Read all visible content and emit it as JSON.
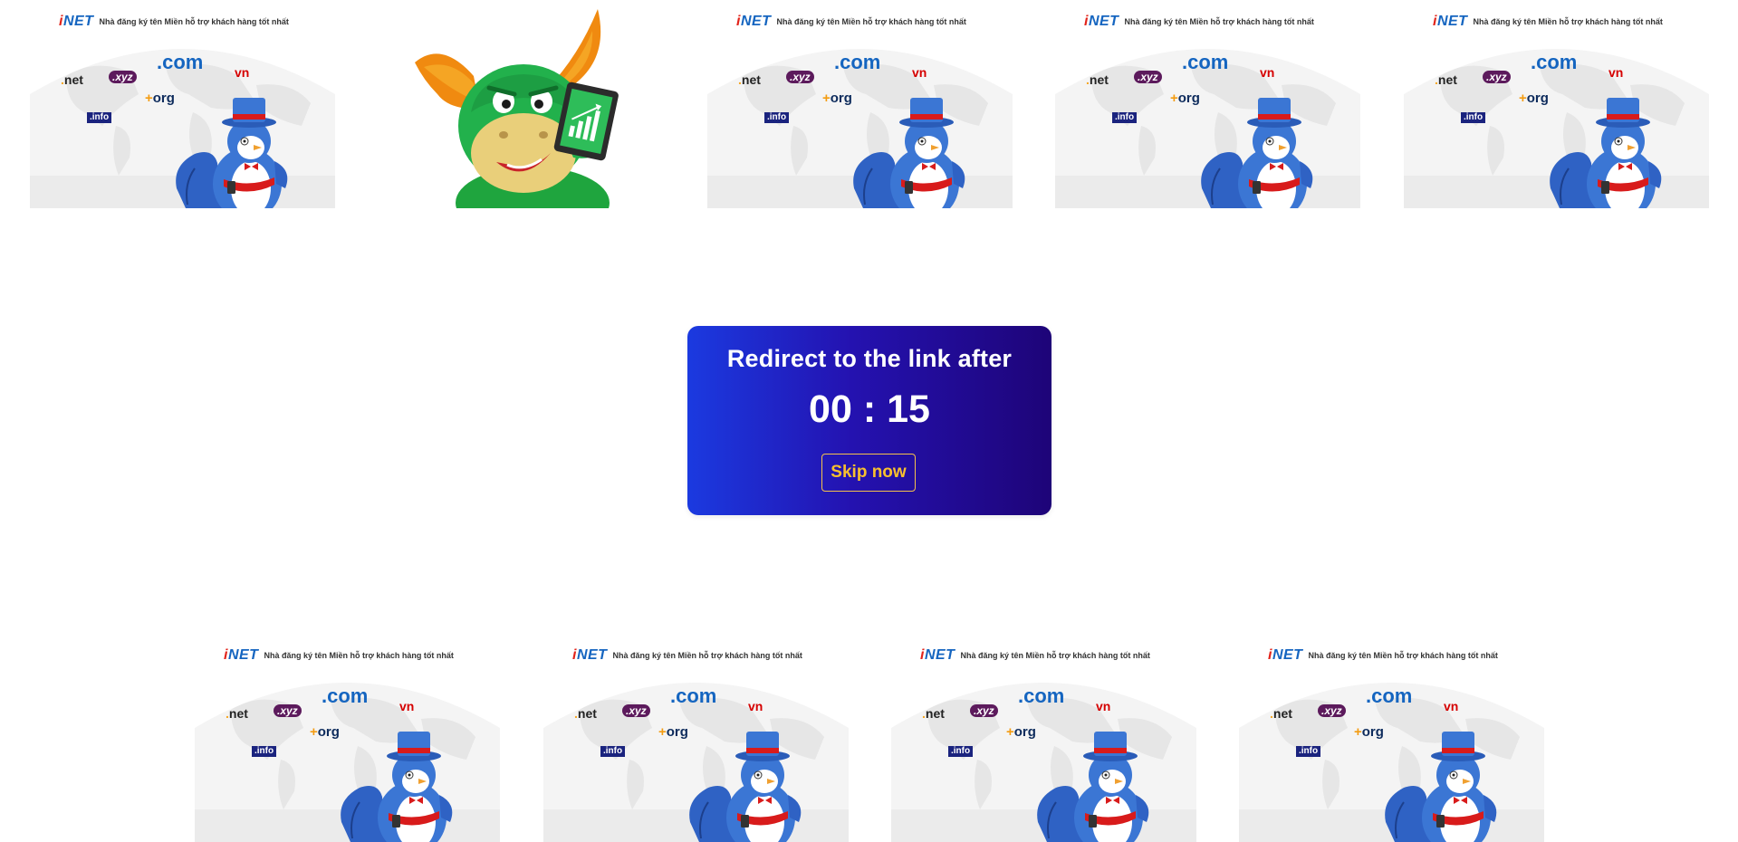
{
  "ads": {
    "logo": {
      "i": "i",
      "rest": "NET"
    },
    "tagline": "Nhà đăng ký tên Miền hỗ trợ khách hàng tốt nhất",
    "tlds": {
      "com": ".com",
      "vn": "vn",
      "net_dot": ".",
      "net": "net",
      "xyz": ".xyz",
      "org_plus": "+",
      "org": "org",
      "info": ".info"
    }
  },
  "countdown": {
    "heading": "Redirect to the link after",
    "minutes": "00",
    "separator": ":",
    "seconds": "15",
    "skip_label": "Skip now"
  },
  "colors": {
    "countdown_gradient_start": "#1b3ae0",
    "countdown_gradient_end": "#1e0478",
    "skip_text": "#f8c02e",
    "inet_red": "#e2231a",
    "inet_blue": "#1565c0"
  }
}
